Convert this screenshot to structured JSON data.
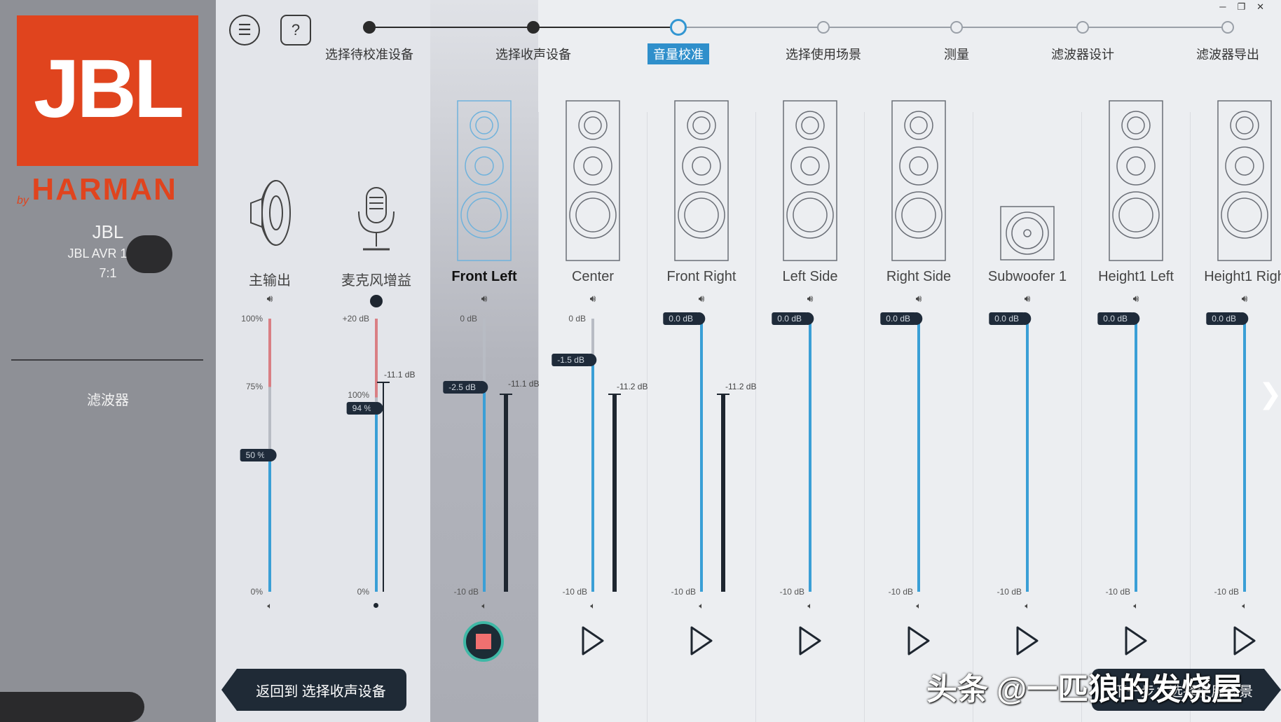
{
  "window": {
    "controls": [
      "─",
      "❐",
      "✕"
    ]
  },
  "sidebar": {
    "logo_text": "JBL",
    "by_text": "by",
    "harman_text": "HARMAN",
    "brand": "JBL",
    "model": "JBL AVR 1000",
    "ratio": "7:1",
    "filter_label": "滤波器",
    "accent": "#e0441e"
  },
  "toolbar": {
    "menu_icon": "☰",
    "help_icon": "?"
  },
  "steps": [
    {
      "label": "选择待校准设备",
      "state": "done"
    },
    {
      "label": "选择收声设备",
      "state": "done"
    },
    {
      "label": "音量校准",
      "state": "active"
    },
    {
      "label": "选择使用场景",
      "state": "todo"
    },
    {
      "label": "测量",
      "state": "todo"
    },
    {
      "label": "滤波器设计",
      "state": "todo"
    },
    {
      "label": "滤波器导出",
      "state": "todo"
    }
  ],
  "main_output": {
    "name": "主输出",
    "scale": [
      "100%",
      "75%",
      "0%"
    ],
    "value_label": "50 %",
    "value": 0.5
  },
  "mic_gain": {
    "name": "麦克风增益",
    "scale": [
      "+20 dB",
      "100%",
      "0%"
    ],
    "value_label": "94 %",
    "value": 0.94,
    "level_label": "-11.1 dB"
  },
  "channels": [
    {
      "name": "Front Left",
      "type": "tower",
      "active": true,
      "top_label": "0 dB",
      "badge": "-2.5 dB",
      "gain_db": -2.5,
      "level_label": "-11.1 dB",
      "bottom_label": "-10 dB"
    },
    {
      "name": "Center",
      "type": "tower",
      "active": false,
      "top_label": "0 dB",
      "badge": "-1.5 dB",
      "gain_db": -1.5,
      "level_label": "-11.2 dB",
      "bottom_label": "-10 dB"
    },
    {
      "name": "Front Right",
      "type": "tower",
      "active": false,
      "top_label": "",
      "badge": "0.0 dB",
      "gain_db": 0,
      "level_label": "-11.2 dB",
      "bottom_label": "-10 dB"
    },
    {
      "name": "Left Side",
      "type": "tower",
      "active": false,
      "top_label": "",
      "badge": "0.0 dB",
      "gain_db": 0,
      "level_label": "",
      "bottom_label": "-10 dB"
    },
    {
      "name": "Right Side",
      "type": "tower",
      "active": false,
      "top_label": "",
      "badge": "0.0 dB",
      "gain_db": 0,
      "level_label": "",
      "bottom_label": "-10 dB"
    },
    {
      "name": "Subwoofer 1",
      "type": "sub",
      "active": false,
      "top_label": "",
      "badge": "0.0 dB",
      "gain_db": 0,
      "level_label": "",
      "bottom_label": "-10 dB"
    },
    {
      "name": "Height1 Left",
      "type": "tower",
      "active": false,
      "top_label": "",
      "badge": "0.0 dB",
      "gain_db": 0,
      "level_label": "",
      "bottom_label": "-10 dB"
    },
    {
      "name": "Height1 Righ",
      "type": "tower",
      "active": false,
      "top_label": "",
      "badge": "0.0 dB",
      "gain_db": 0,
      "level_label": "",
      "bottom_label": "-10 dB"
    }
  ],
  "footer": {
    "back_label": "返回到 选择收声设备",
    "next_label": "下一步：选择使用场景"
  },
  "watermark": "头条 @一匹狼的发烧屋",
  "colors": {
    "track_blue": "#3a9fd6",
    "track_red": "#d97f84",
    "badge_bg": "#1f2b3a",
    "stop_ring": "#3fb8a6",
    "stop_square": "#f07070"
  }
}
